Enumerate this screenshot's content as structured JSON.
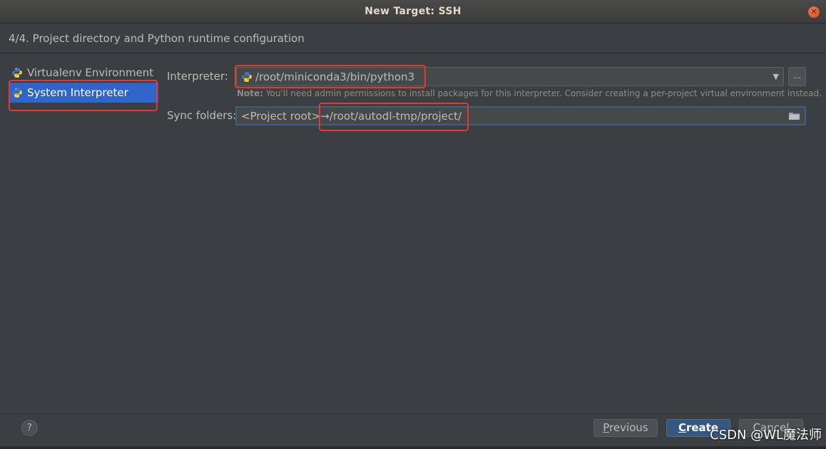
{
  "window": {
    "title": "New Target: SSH"
  },
  "step": {
    "header": "4/4. Project directory and Python runtime configuration"
  },
  "environments": [
    {
      "label": "Virtualenv Environment",
      "icon": "python-icon",
      "selected": false
    },
    {
      "label": "System Interpreter",
      "icon": "python-icon",
      "selected": true
    }
  ],
  "interpreter": {
    "label": "Interpreter:",
    "value": "/root/miniconda3/bin/python3",
    "browse_label": "...",
    "note_prefix": "Note:",
    "note_text": " You'll need admin permissions to install packages for this interpreter. Consider creating a per-project virtual environment instead."
  },
  "sync": {
    "label": "Sync folders:",
    "value": "<Project root>→/root/autodl-tmp/project/"
  },
  "footer": {
    "help_label": "?",
    "previous_label_u": "P",
    "previous_label_rest": "revious",
    "create_label_u": "C",
    "create_label_rest": "reate",
    "cancel_label": "Cancel"
  },
  "watermark": "CSDN @WL魔法师",
  "colors": {
    "accent": "#2f65ca",
    "highlight": "#e53935",
    "primary_button": "#365880"
  }
}
